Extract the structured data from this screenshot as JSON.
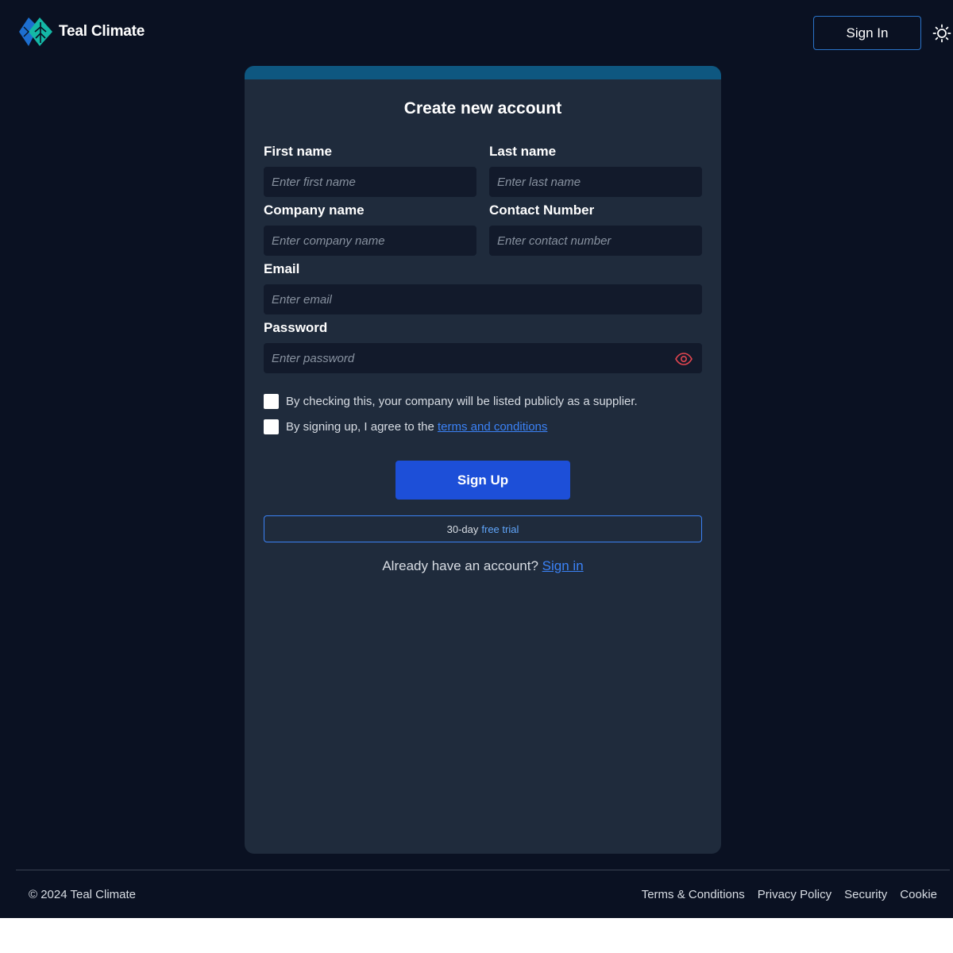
{
  "brand": {
    "name": "Teal Climate",
    "logo_icon": "leaf-diamond-icon",
    "accent_color": "#14b8a6"
  },
  "header": {
    "signin_label": "Sign In",
    "theme_icon": "sun-icon"
  },
  "form": {
    "title": "Create new account",
    "first_name": {
      "label": "First name",
      "placeholder": "Enter first name"
    },
    "last_name": {
      "label": "Last name",
      "placeholder": "Enter last name"
    },
    "company_name": {
      "label": "Company name",
      "placeholder": "Enter company name"
    },
    "contact_number": {
      "label": "Contact Number",
      "placeholder": "Enter contact number"
    },
    "email": {
      "label": "Email",
      "placeholder": "Enter email"
    },
    "password": {
      "label": "Password",
      "placeholder": "Enter password",
      "toggle_icon": "eye-icon"
    },
    "supplier_check": {
      "label": "By checking this, your company will be listed publicly as a supplier.",
      "checked": false
    },
    "terms_check": {
      "label_prefix": "By signing up, I agree to the",
      "link": "terms and conditions",
      "checked": false
    },
    "submit_label": "Sign Up",
    "trial": {
      "prefix": "30-day",
      "accent": "free trial"
    },
    "already": {
      "text": "Already have an account?",
      "link": "Sign in"
    }
  },
  "footer": {
    "copyright": "© 2024 Teal Climate",
    "links": [
      "Terms & Conditions",
      "Privacy Policy",
      "Security",
      "Cookie"
    ]
  },
  "colors": {
    "background": "#0a1122",
    "card": "#1f2b3c",
    "card_topbar": "#0e5780",
    "input": "#121a2b",
    "primary_button": "#1d4fd8",
    "link": "#3b82f6",
    "eye_icon": "#e0454f"
  }
}
